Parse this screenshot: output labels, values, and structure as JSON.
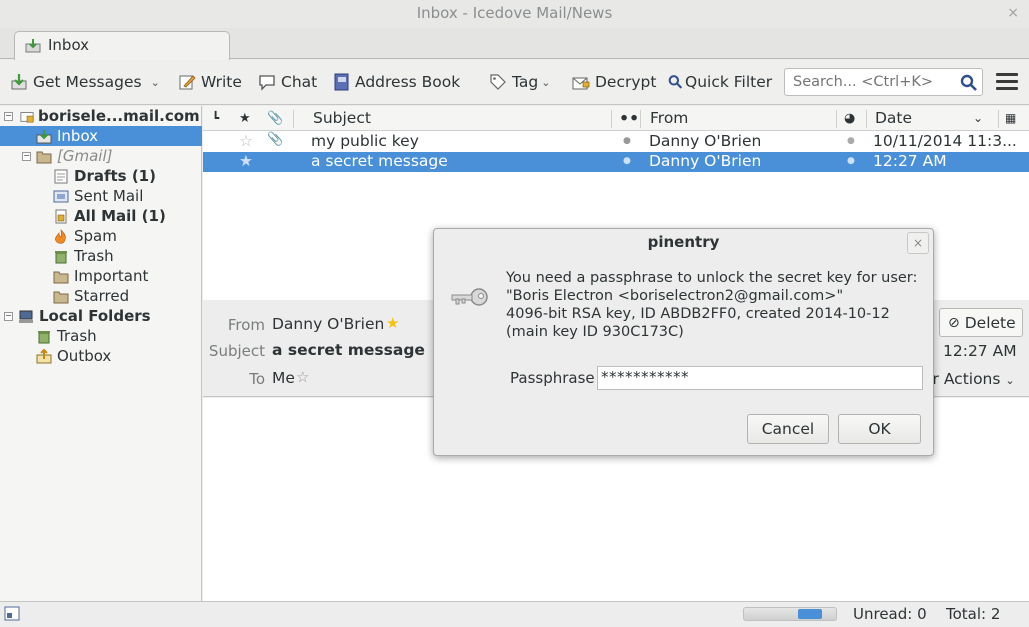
{
  "window": {
    "title": "Inbox - Icedove Mail/News",
    "close_glyph": "×"
  },
  "tabs": [
    {
      "label": "Inbox",
      "icon": "inbox-icon"
    }
  ],
  "toolbar": {
    "get_messages": "Get Messages",
    "write": "Write",
    "chat": "Chat",
    "address_book": "Address Book",
    "tag": "Tag",
    "decrypt": "Decrypt",
    "quick_filter": "Quick Filter",
    "search_placeholder": "Search... <Ctrl+K>"
  },
  "folders": {
    "account": "borisele...mail.com",
    "inbox": "Inbox",
    "gmail": "[Gmail]",
    "drafts": "Drafts (1)",
    "sent": "Sent Mail",
    "all_mail": "All Mail (1)",
    "spam": "Spam",
    "trash": "Trash",
    "important": "Important",
    "starred": "Starred",
    "local": "Local Folders",
    "local_trash": "Trash",
    "outbox": "Outbox"
  },
  "thread_columns": {
    "subject": "Subject",
    "from": "From",
    "date": "Date"
  },
  "messages": [
    {
      "subject": "my public key",
      "from": "Danny O'Brien",
      "date": "10/11/2014 11:3...",
      "selected": false
    },
    {
      "subject": "a secret message",
      "from": "Danny O'Brien",
      "date": "12:27 AM",
      "selected": true
    }
  ],
  "header": {
    "from_label": "From",
    "from_value": "Danny O'Brien",
    "subject_label": "Subject",
    "subject_value": "a secret message",
    "to_label": "To",
    "to_value": "Me",
    "delete": "Delete",
    "time": "12:27 AM",
    "other_actions": "er Actions"
  },
  "status": {
    "unread": "Unread: 0",
    "total": "Total: 2",
    "progress": 0.7
  },
  "dialog": {
    "title": "pinentry",
    "close_glyph": "×",
    "line1": "You need a passphrase to unlock the secret key for user:",
    "line2": "\"Boris Electron <boriselectron2@gmail.com>\"",
    "line3": "4096-bit RSA key, ID ABDB2FF0, created 2014-10-12",
    "line4": "(main key ID 930C173C)",
    "passphrase_label": "Passphrase",
    "passphrase_value": "***********",
    "cancel": "Cancel",
    "ok": "OK"
  },
  "colors": {
    "selection": "#4a90d9",
    "accent_star": "#f5c211"
  }
}
